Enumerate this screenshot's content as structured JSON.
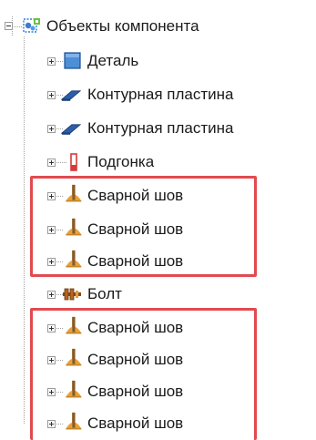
{
  "tree": {
    "root": {
      "label": "Объекты компонента",
      "icon": "component-objects-icon"
    },
    "items": [
      {
        "label": "Деталь",
        "icon": "part-icon"
      },
      {
        "label": "Контурная пластина",
        "icon": "contour-plate-icon"
      },
      {
        "label": "Контурная пластина",
        "icon": "contour-plate-icon"
      },
      {
        "label": "Подгонка",
        "icon": "fitting-icon"
      },
      {
        "label": "Сварной шов",
        "icon": "weld-icon"
      },
      {
        "label": "Сварной шов",
        "icon": "weld-icon"
      },
      {
        "label": "Сварной шов",
        "icon": "weld-icon"
      },
      {
        "label": "Болт",
        "icon": "bolt-icon"
      },
      {
        "label": "Сварной шов",
        "icon": "weld-icon"
      },
      {
        "label": "Сварной шов",
        "icon": "weld-icon"
      },
      {
        "label": "Сварной шов",
        "icon": "weld-icon"
      },
      {
        "label": "Сварной шов",
        "icon": "weld-icon"
      }
    ]
  },
  "colors": {
    "highlight": "#e24a4f",
    "part_fill": "#4c8fd6",
    "weld_orange": "#e8a23a",
    "plate_blue": "#2d5ea8",
    "fitting_red": "#d83a3a",
    "bolt_brown": "#8a4a16"
  }
}
